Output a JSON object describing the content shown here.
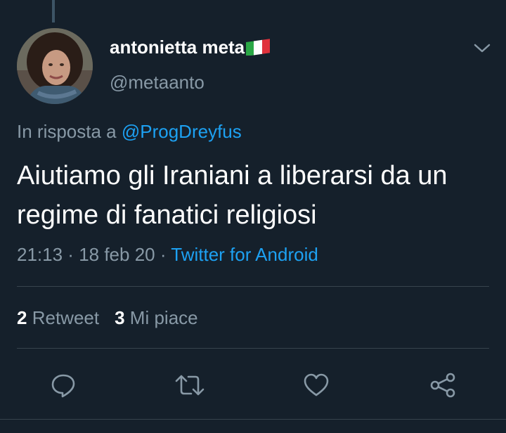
{
  "author": {
    "display_name": "antonietta meta",
    "flag_icon": "italy-flag-icon",
    "handle": "@metaanto"
  },
  "reply": {
    "prefix": "In risposta a ",
    "mention": "@ProgDreyfus"
  },
  "tweet": {
    "text": "Aiutiamo gli Iraniani a liberarsi da un regime di fanatici religiosi"
  },
  "meta": {
    "time": "21:13",
    "separator1": " · ",
    "date": "18 feb 20",
    "separator2": " · ",
    "source": "Twitter for Android"
  },
  "stats": {
    "retweet_count": "2",
    "retweet_label": "Retweet",
    "like_count": "3",
    "like_label": "Mi piace"
  },
  "actions": {
    "reply_icon": "reply-icon",
    "retweet_icon": "retweet-icon",
    "like_icon": "heart-icon",
    "share_icon": "share-icon"
  },
  "colors": {
    "background": "#15202b",
    "primary_text": "#ffffff",
    "secondary_text": "#8899a6",
    "accent": "#1da1f2",
    "divider": "#38444d"
  }
}
